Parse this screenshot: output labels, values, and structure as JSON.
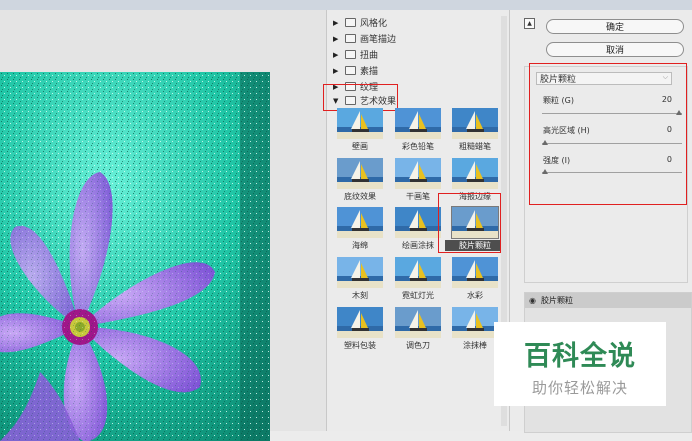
{
  "dialog": {
    "ok_label": "确定",
    "cancel_label": "取消"
  },
  "gallery": {
    "categories": [
      {
        "label": "风格化",
        "expanded": false
      },
      {
        "label": "画笔描边",
        "expanded": false
      },
      {
        "label": "扭曲",
        "expanded": false
      },
      {
        "label": "素描",
        "expanded": false
      },
      {
        "label": "纹理",
        "expanded": false
      },
      {
        "label": "艺术效果",
        "expanded": true
      }
    ],
    "filters": [
      {
        "label": "壁画"
      },
      {
        "label": "彩色铅笔"
      },
      {
        "label": "粗糙蜡笔"
      },
      {
        "label": "底纹效果"
      },
      {
        "label": "干画笔"
      },
      {
        "label": "海报边缘"
      },
      {
        "label": "海绵"
      },
      {
        "label": "绘画涂抹"
      },
      {
        "label": "胶片颗粒"
      },
      {
        "label": "木刻"
      },
      {
        "label": "霓虹灯光"
      },
      {
        "label": "水彩"
      },
      {
        "label": "塑料包装"
      },
      {
        "label": "调色刀"
      },
      {
        "label": "涂抹棒"
      }
    ],
    "selected_filter": "胶片颗粒"
  },
  "settings": {
    "filter_name": "胶片颗粒",
    "params": [
      {
        "label": "颗粒 (G)",
        "value": "20",
        "level": 1.0
      },
      {
        "label": "高光区域 (H)",
        "value": "0",
        "level": 0.0
      },
      {
        "label": "强度 (I)",
        "value": "0",
        "level": 0.0
      }
    ]
  },
  "layer": {
    "label": "胶片颗粒"
  },
  "watermark": {
    "title": "百科全说",
    "subtitle": "助你轻松解决"
  },
  "colors": {
    "highlight_red": "#e02020",
    "watermark_green": "#2f8a56"
  }
}
